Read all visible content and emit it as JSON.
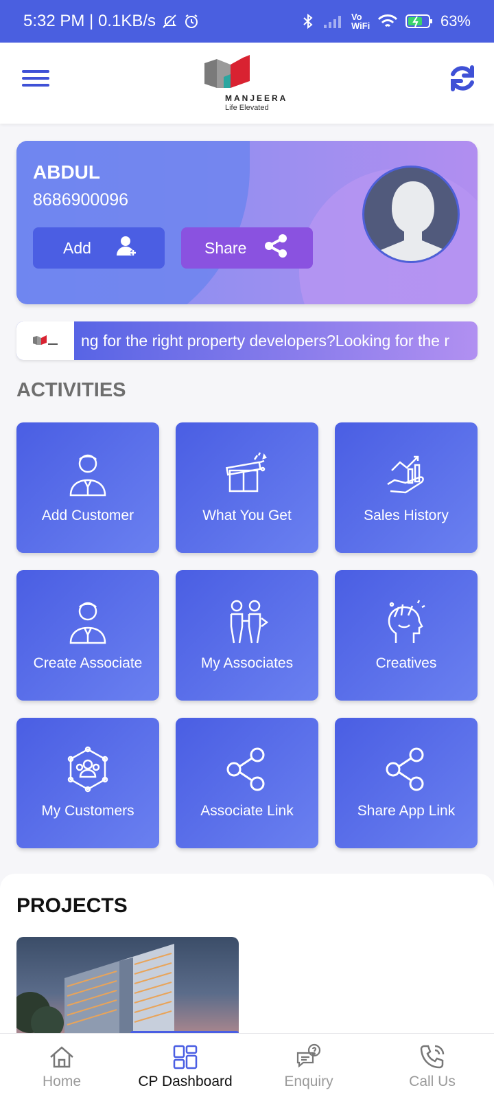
{
  "status_bar": {
    "time": "5:32 PM | 0.1KB/s",
    "network": "Vo WiFi",
    "battery": "63%"
  },
  "header": {
    "brand": "MANJEERA",
    "tagline": "Life Elevated",
    "menu_icon": "hamburger-icon",
    "refresh_icon": "refresh-icon",
    "brand_colors": [
      "#d92231",
      "#7a7a7a",
      "#2aa6a0"
    ]
  },
  "profile": {
    "name": "ABDUL",
    "phone": "8686900096",
    "add_label": "Add",
    "share_label": "Share"
  },
  "marquee": {
    "text": "ng for the right property developers?Looking for the r"
  },
  "activities": {
    "title": "ACTIVITIES",
    "tiles": [
      {
        "label": "Add Customer",
        "icon": "user-tie-icon"
      },
      {
        "label": "What You Get",
        "icon": "gift-icon"
      },
      {
        "label": "Sales History",
        "icon": "chart-hand-icon"
      },
      {
        "label": "Create Associate",
        "icon": "user-tie-icon"
      },
      {
        "label": "My Associates",
        "icon": "people-icon"
      },
      {
        "label": "Creatives",
        "icon": "creative-head-icon"
      },
      {
        "label": "My Customers",
        "icon": "network-icon"
      },
      {
        "label": "Associate Link",
        "icon": "share-icon"
      },
      {
        "label": "Share App Link",
        "icon": "share-icon"
      }
    ]
  },
  "projects": {
    "title": "PROJECTS"
  },
  "bottom_nav": {
    "items": [
      {
        "label": "Home",
        "icon": "home-icon"
      },
      {
        "label": "CP Dashboard",
        "icon": "dashboard-icon"
      },
      {
        "label": "Enquiry",
        "icon": "enquiry-icon"
      },
      {
        "label": "Call Us",
        "icon": "phone-icon"
      }
    ],
    "active": "CP Dashboard"
  },
  "colors": {
    "primary": "#4a5fe0",
    "purple": "#8a52e0"
  }
}
